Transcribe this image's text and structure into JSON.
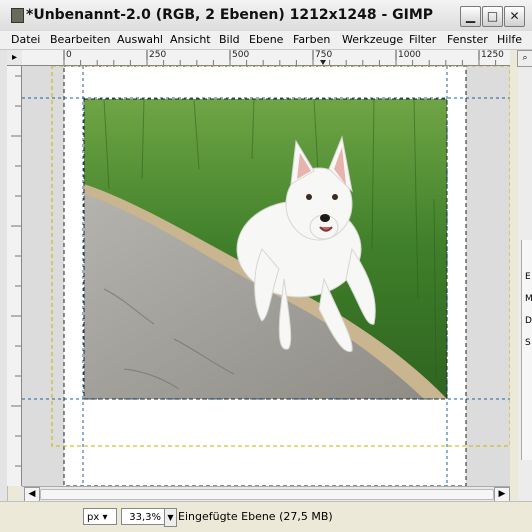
{
  "window": {
    "title": "*Unbenannt-2.0 (RGB, 2 Ebenen) 1212x1248 - GIMP",
    "minimize_glyph": "▁",
    "maximize_glyph": "□",
    "close_glyph": "✕"
  },
  "menu": {
    "items": [
      "Datei",
      "Bearbeiten",
      "Auswahl",
      "Ansicht",
      "Bild",
      "Ebene",
      "Farben",
      "Werkzeuge",
      "Filter",
      "Fenster",
      "Hilfe"
    ]
  },
  "ruler": {
    "labels": [
      "0",
      "250",
      "500",
      "750",
      "1000",
      "1250"
    ]
  },
  "side_panel": {
    "letters": [
      "E",
      "M",
      "D",
      "S"
    ]
  },
  "status": {
    "unit": "px",
    "zoom": "33,3%",
    "message": "Eingefügte Ebene (27,5 MB)"
  },
  "colors": {
    "canvas_bg": "#dcdcdc",
    "guide": "#1f5f9f",
    "grass": "#3d7a26",
    "road": "#a9a9a5"
  },
  "icons": [
    "app-icon",
    "minimize-icon",
    "maximize-icon",
    "close-icon",
    "pointer-navigation-icon",
    "zoom-icon",
    "scroll-left-icon",
    "scroll-right-icon"
  ]
}
